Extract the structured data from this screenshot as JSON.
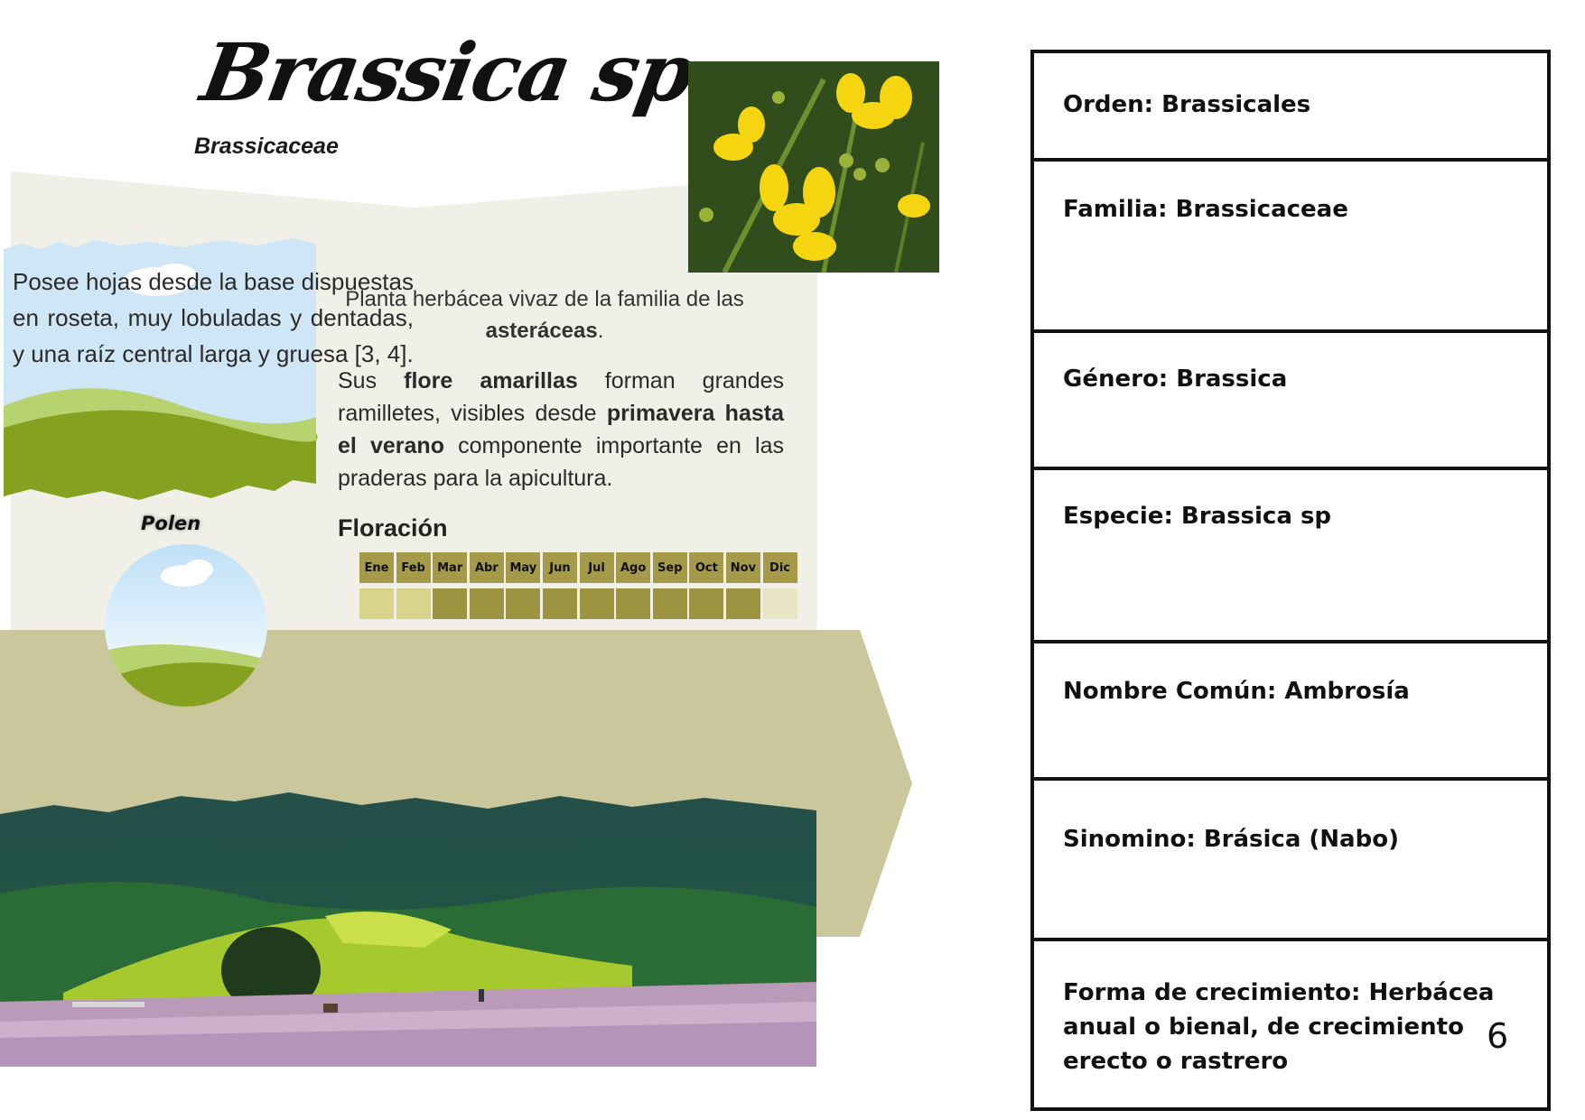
{
  "header": {
    "title": "Brassica sp.",
    "subtitle": "Brassicaceae"
  },
  "description_left": "Posee hojas desde la base dispuestas en roseta, muy lobuladas y dentadas, y una raíz central larga y gruesa [3, 4].",
  "intro": {
    "before": "Planta herbácea vivaz de la familia de las ",
    "bold": "asteráceas",
    "after": "."
  },
  "description_right": {
    "t1": "Sus ",
    "b1": "flore amarillas",
    "t2": " forman grandes ramilletes, visibles desde ",
    "b2": "primavera hasta el verano",
    "t3": " componente importante en las praderas para la apicultura."
  },
  "polen_label": "Polen",
  "floracion": {
    "label": "Floración",
    "months": [
      "Ene",
      "Feb",
      "Mar",
      "Abr",
      "May",
      "Jun",
      "Jul",
      "Ago",
      "Sep",
      "Oct",
      "Nov",
      "Dic"
    ],
    "intensity": [
      1,
      1,
      2,
      2,
      2,
      2,
      2,
      2,
      2,
      2,
      2,
      0
    ]
  },
  "taxonomy": {
    "orden": "Orden: Brassicales",
    "familia": "Familia: Brassicaceae",
    "genero": "Género: Brassica",
    "especie": "Especie: Brassica sp",
    "nombre_comun": "Nombre Común:  Ambrosía",
    "sinonimo": "Sinomino:  Brásica (Nabo)",
    "forma_crecimiento": "Forma de crecimiento: Herbácea anual o bienal, de crecimiento erecto o rastrero"
  },
  "page_number": "6",
  "colors": {
    "panel_light": "#f1f0e8",
    "olive_band": "#cac79c",
    "month_header": "#a59a4a",
    "bloom_low": "#d9d48c",
    "bloom_high": "#9c9441",
    "bloom_none": "#e8e5c4"
  }
}
